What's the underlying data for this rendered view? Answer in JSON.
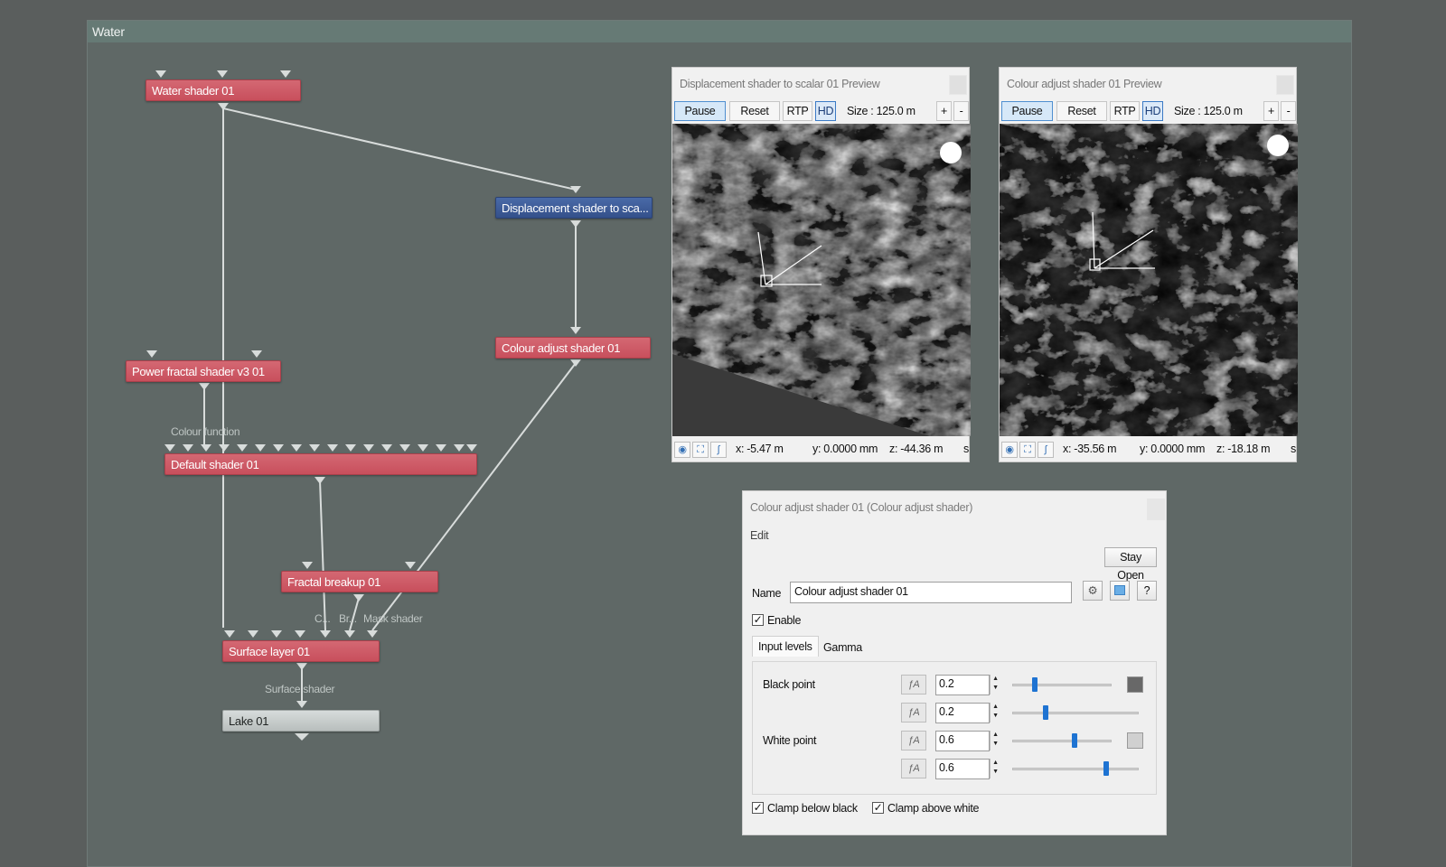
{
  "window": {
    "title": "Water"
  },
  "graph": {
    "nodes": {
      "water_shader": "Water shader 01",
      "displacement_shader": "Displacement shader to sca...",
      "colour_adjust": "Colour adjust shader 01",
      "power_fractal": "Power fractal shader v3 01",
      "default_shader": "Default shader 01",
      "fractal_breakup": "Fractal breakup 01",
      "surface_layer": "Surface layer 01",
      "lake": "Lake 01"
    },
    "port_labels": {
      "colour_function": "Colour function",
      "c": "C...",
      "br": "Br...",
      "mask_shader": "Mask shader",
      "surface_shader": "Surface shader"
    }
  },
  "previews": [
    {
      "title": "Displacement shader to scalar 01 Preview",
      "pause": "Pause",
      "reset": "Reset",
      "rtp": "RTP",
      "hd": "HD",
      "size": "Size :  125.0 m",
      "plus": "+",
      "minus": "-",
      "x": "x:  -5.47 m",
      "y": "y:  0.0000 mm",
      "z": "z:  -44.36 m",
      "s": "s"
    },
    {
      "title": "Colour adjust shader 01 Preview",
      "pause": "Pause",
      "reset": "Reset",
      "rtp": "RTP",
      "hd": "HD",
      "size": "Size :  125.0 m",
      "plus": "+",
      "minus": "-",
      "x": "x:  -35.56 m",
      "y": "y:  0.0000 mm",
      "z": "z:  -18.18 m",
      "s": "s"
    }
  ],
  "dialog": {
    "title": "Colour adjust shader 01    (Colour adjust shader)",
    "menu": "Edit",
    "stay_open": "Stay Open",
    "name_label": "Name",
    "name_value": "Colour adjust shader 01",
    "help": "?",
    "enable_label": "Enable",
    "tabs": [
      "Input levels",
      "Gamma"
    ],
    "black_point_label": "Black point",
    "white_point_label": "White point",
    "values": [
      "0.2",
      "0.2",
      "0.6",
      "0.6"
    ],
    "slider_levels": [
      0.2,
      0.2,
      0.6,
      0.6
    ],
    "clamp_below": "Clamp below black",
    "clamp_above": "Clamp above white"
  }
}
